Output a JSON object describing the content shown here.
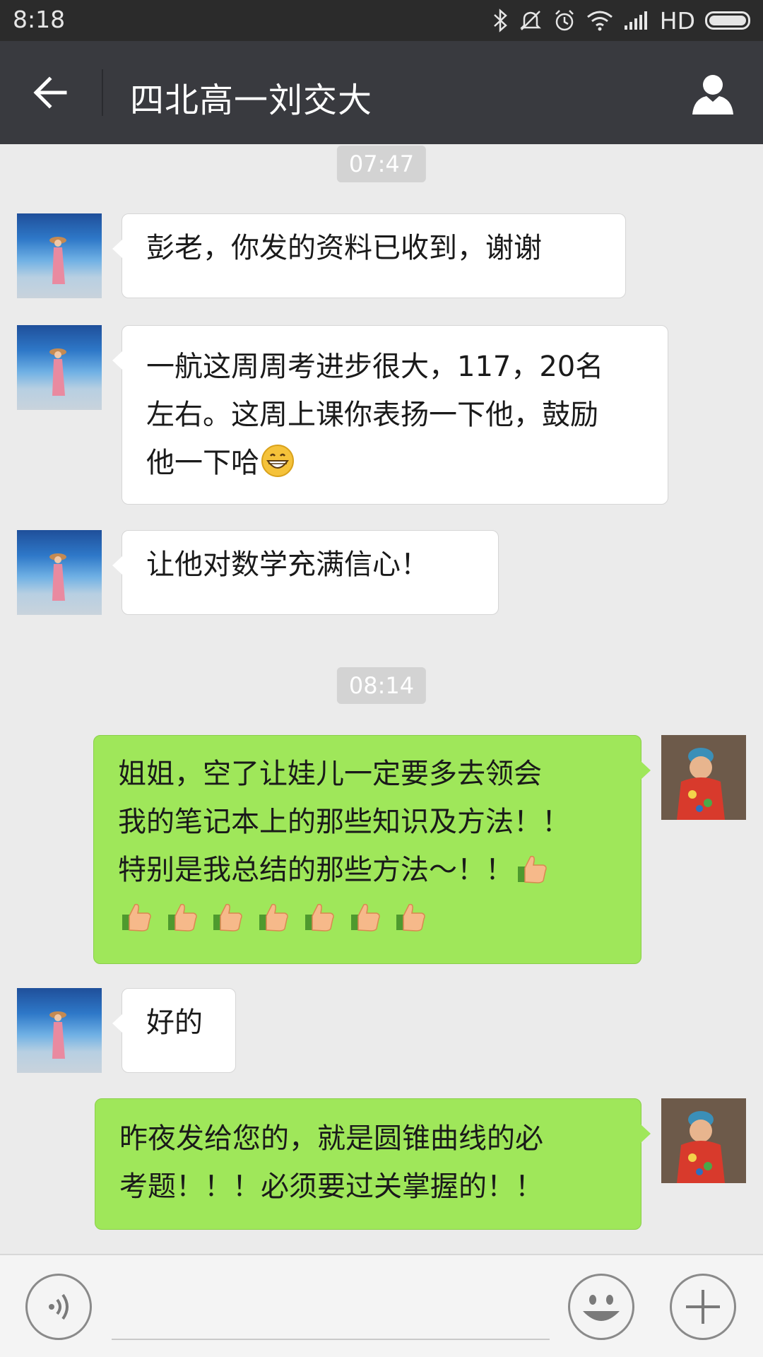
{
  "status_bar": {
    "time": "8:18",
    "network_label": "HD",
    "icons": [
      "bluetooth-icon",
      "mute-icon",
      "alarm-icon",
      "wifi-icon",
      "signal-icon",
      "battery-icon"
    ]
  },
  "header": {
    "title": "四北高一刘交大",
    "back_icon": "back-arrow-icon",
    "profile_icon": "person-icon"
  },
  "chat": {
    "timestamps": [
      "07:47",
      "08:14"
    ],
    "messages": [
      {
        "side": "left",
        "text": "彭老，你发的资料已收到，谢谢"
      },
      {
        "side": "left",
        "line1": "一航这周周考进步很大，117，20名",
        "line2": "左右。这周上课你表扬一下他，鼓励",
        "line3": "他一下哈",
        "emoji": "grinning-face"
      },
      {
        "side": "left",
        "text": "让他对数学充满信心！"
      },
      {
        "side": "right",
        "line1": "姐姐，空了让娃儿一定要多去领会",
        "line2": "我的笔记本上的那些知识及方法！！",
        "line3": "特别是我总结的那些方法～！！",
        "emoji": "thumbs-up",
        "thumbs_count_line4": 7
      },
      {
        "side": "left",
        "text": "好的"
      },
      {
        "side": "right",
        "line1": "昨夜发给您的，就是圆锥曲线的必",
        "line2": "考题！！！必须要过关掌握的！！"
      }
    ]
  },
  "input_bar": {
    "placeholder": "",
    "icons": [
      "voice-icon",
      "emoji-face-icon",
      "plus-icon"
    ]
  },
  "colors": {
    "chat_bg": "#ebebeb",
    "header_bg": "#393a3f",
    "sent_bubble": "#9fe75a",
    "received_bubble": "#ffffff"
  }
}
